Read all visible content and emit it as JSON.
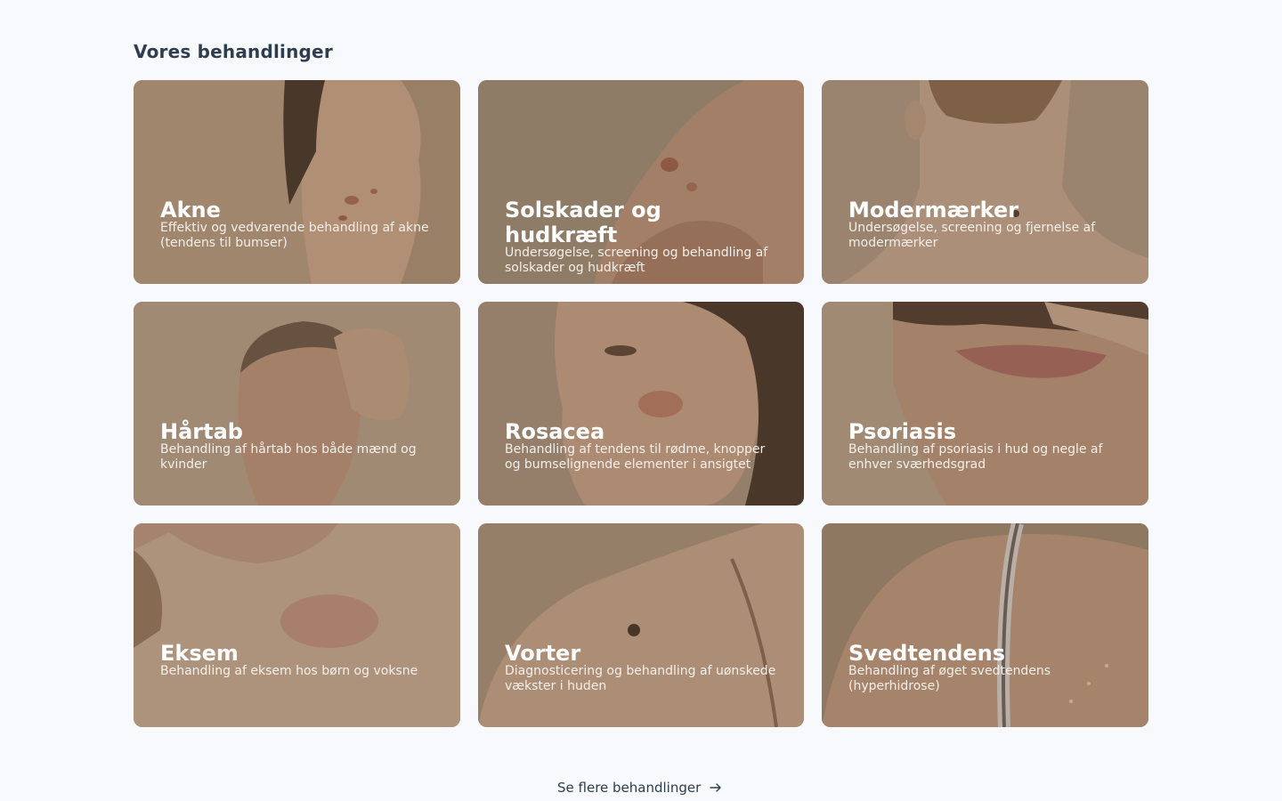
{
  "section": {
    "title": "Vores behandlinger",
    "more_link": "Se flere behandlinger",
    "more_icon": "arrow-right-icon"
  },
  "colors": {
    "background": "#f7f9fc",
    "heading": "#2f3e4e",
    "card_overlay": "rgba(98, 78, 58, 0.35)",
    "card_text": "#ffffff"
  },
  "cards": [
    {
      "title": "Akne",
      "description": "Effektiv og vedvarende behandling af akne (tendens til bumser)",
      "image": "woman-profile-acne-photo"
    },
    {
      "title": "Solskader og hudkræft",
      "description": "Undersøgelse, screening og behandling af solskader og hudkræft",
      "image": "nose-sun-damage-photo"
    },
    {
      "title": "Modermærker",
      "description": "Undersøgelse, screening og fjernelse af modermærker",
      "image": "neck-mole-photo"
    },
    {
      "title": "Hårtab",
      "description": "Behandling af hårtab hos både mænd og kvinder",
      "image": "man-hair-loss-photo"
    },
    {
      "title": "Rosacea",
      "description": "Behandling af tendens til rødme, knopper og bumselignende elementer i ansigtet",
      "image": "woman-rosacea-photo"
    },
    {
      "title": "Psoriasis",
      "description": "Behandling af psoriasis i hud og negle af enhver sværhedsgrad",
      "image": "neck-psoriasis-photo"
    },
    {
      "title": "Eksem",
      "description": "Behandling af eksem hos børn og voksne",
      "image": "neck-eczema-photo"
    },
    {
      "title": "Vorter",
      "description": "Diagnosticering og behandling af uønskede vækster i huden",
      "image": "shoulder-wart-photo"
    },
    {
      "title": "Svedtendens",
      "description": "Behandling af øget svedtendens (hyperhidrose)",
      "image": "back-sweat-photo"
    }
  ]
}
